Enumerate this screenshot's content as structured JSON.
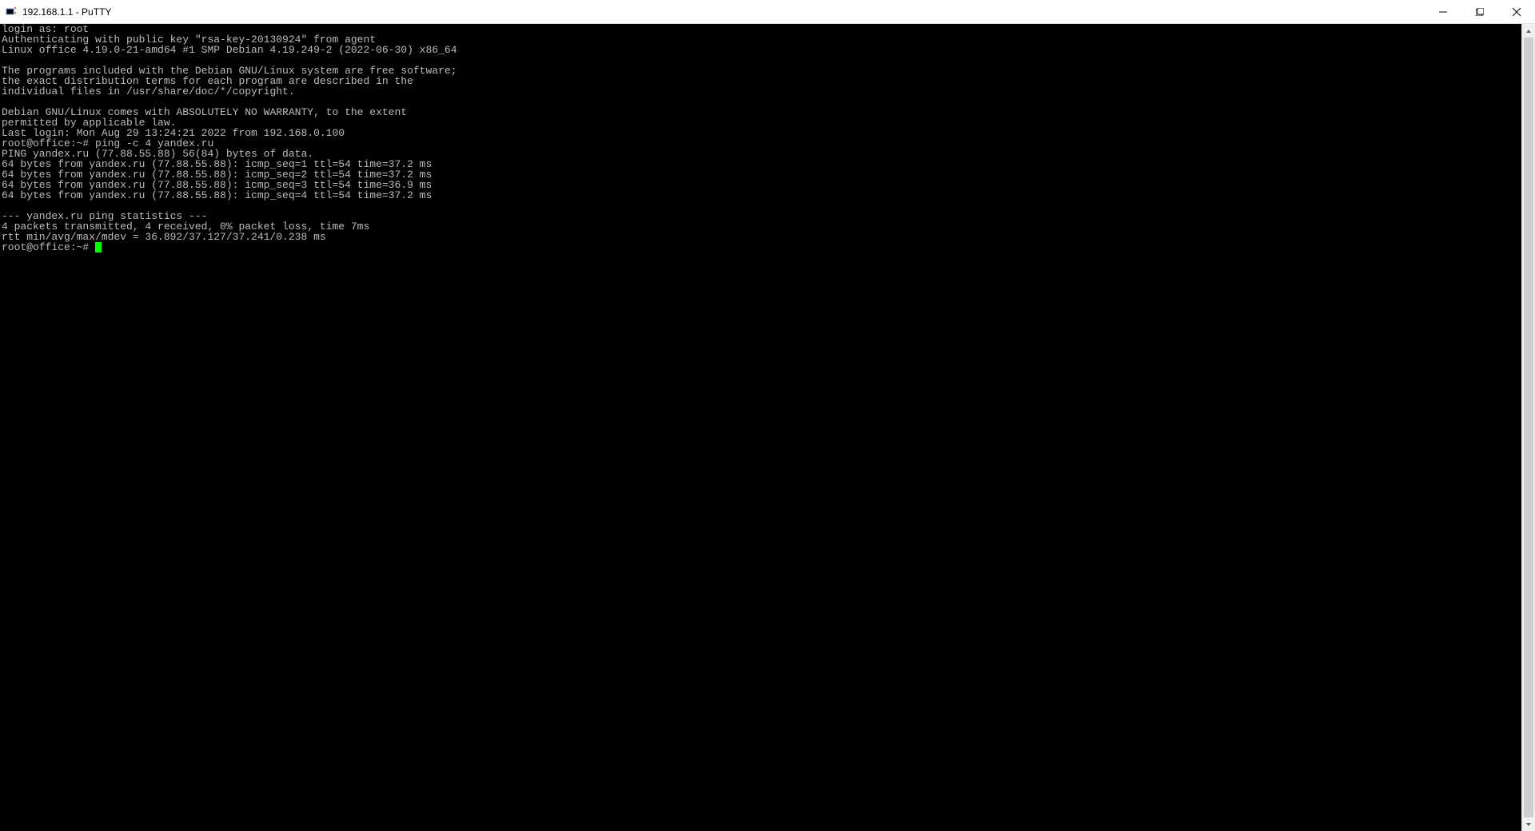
{
  "window": {
    "title": "192.168.1.1 - PuTTY"
  },
  "terminal": {
    "lines": [
      "login as: root",
      "Authenticating with public key \"rsa-key-20130924\" from agent",
      "Linux office 4.19.0-21-amd64 #1 SMP Debian 4.19.249-2 (2022-06-30) x86_64",
      "",
      "The programs included with the Debian GNU/Linux system are free software;",
      "the exact distribution terms for each program are described in the",
      "individual files in /usr/share/doc/*/copyright.",
      "",
      "Debian GNU/Linux comes with ABSOLUTELY NO WARRANTY, to the extent",
      "permitted by applicable law.",
      "Last login: Mon Aug 29 13:24:21 2022 from 192.168.0.100",
      "root@office:~# ping -c 4 yandex.ru",
      "PING yandex.ru (77.88.55.88) 56(84) bytes of data.",
      "64 bytes from yandex.ru (77.88.55.88): icmp_seq=1 ttl=54 time=37.2 ms",
      "64 bytes from yandex.ru (77.88.55.88): icmp_seq=2 ttl=54 time=37.2 ms",
      "64 bytes from yandex.ru (77.88.55.88): icmp_seq=3 ttl=54 time=36.9 ms",
      "64 bytes from yandex.ru (77.88.55.88): icmp_seq=4 ttl=54 time=37.2 ms",
      "",
      "--- yandex.ru ping statistics ---",
      "4 packets transmitted, 4 received, 0% packet loss, time 7ms",
      "rtt min/avg/max/mdev = 36.892/37.127/37.241/0.238 ms"
    ],
    "prompt": "root@office:~# "
  }
}
